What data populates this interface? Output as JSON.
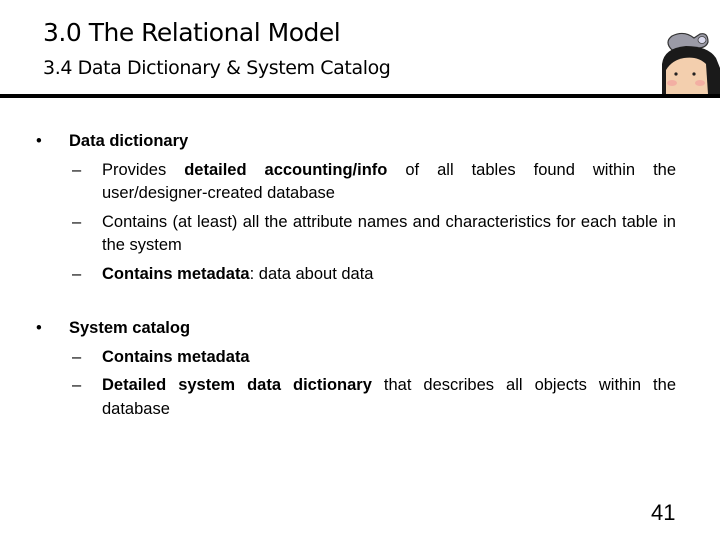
{
  "header": {
    "title": "3.0 The Relational Model",
    "subtitle": "3.4 Data Dictionary & System Catalog",
    "mascot_icon": "cartoon-character-with-cap"
  },
  "content": {
    "sections": [
      {
        "heading": "Data dictionary",
        "items": [
          {
            "pre": "Provides ",
            "bold": "detailed accounting/info",
            "post": " of all tables found within the user/designer-created database"
          },
          {
            "pre": "Contains (at least) all the attribute names and characteristics for each table in the system",
            "bold": "",
            "post": ""
          },
          {
            "pre": "",
            "bold": "Contains metadata",
            "post": ": data about data"
          }
        ]
      },
      {
        "heading": "System catalog",
        "items": [
          {
            "pre": "",
            "bold": "Contains metadata",
            "post": ""
          },
          {
            "pre": "",
            "bold": "Detailed system data dictionary",
            "post": " that describes all objects within the database"
          }
        ]
      }
    ]
  },
  "footer": {
    "page_number": "41"
  },
  "glyphs": {
    "bullet": "•",
    "dash": "–"
  }
}
